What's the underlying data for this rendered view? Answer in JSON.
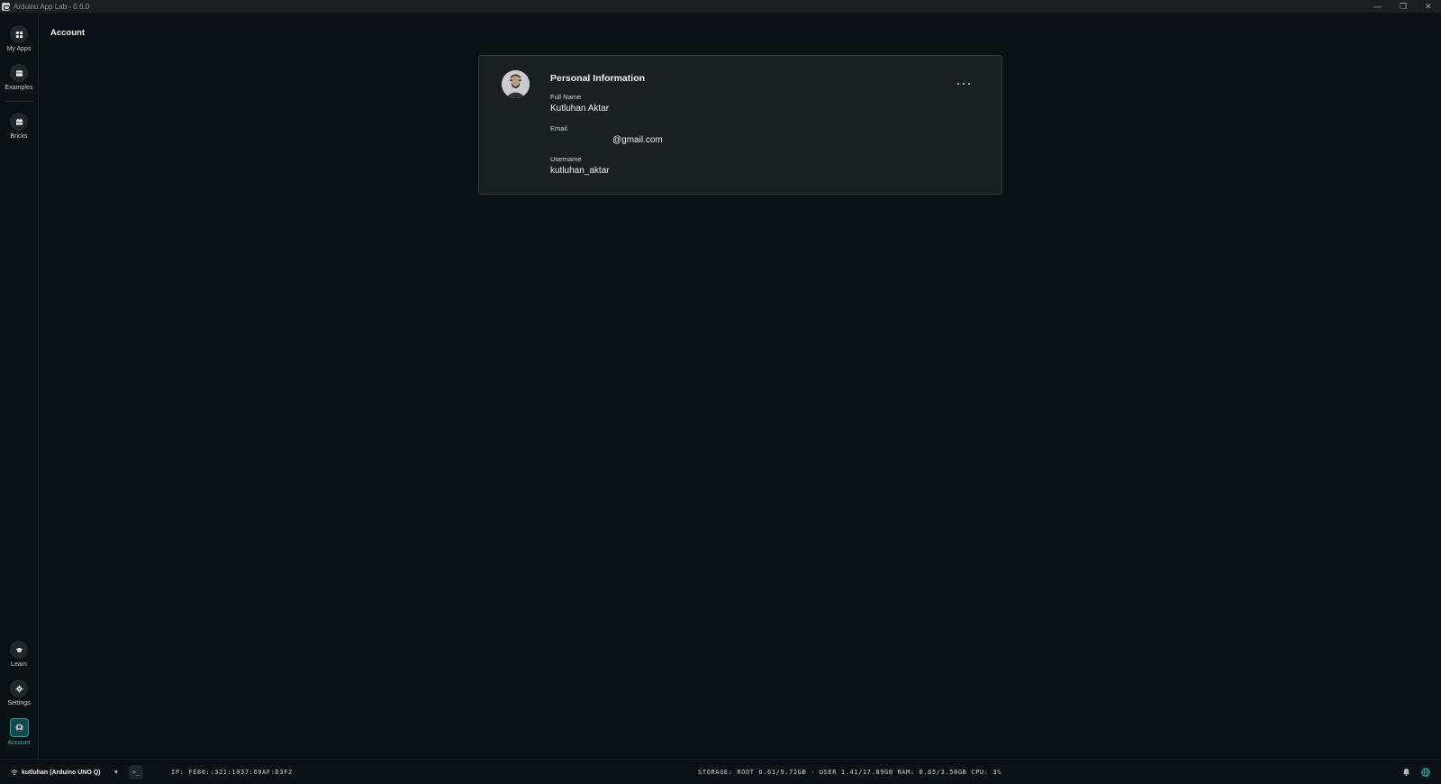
{
  "window": {
    "title": "Arduino App Lab - 0.6.0"
  },
  "sidebar": {
    "top_items": [
      {
        "label": "My Apps",
        "icon": "grid-icon"
      },
      {
        "label": "Examples",
        "icon": "examples-icon"
      },
      {
        "label": "Bricks",
        "icon": "bricks-icon"
      }
    ],
    "bottom_items": [
      {
        "label": "Learn",
        "icon": "graduation-cap-icon"
      },
      {
        "label": "Settings",
        "icon": "gear-icon"
      },
      {
        "label": "Account",
        "icon": "avatar-icon",
        "active": true
      }
    ]
  },
  "page": {
    "title": "Account"
  },
  "personal_info": {
    "heading": "Personal Information",
    "full_name_label": "Full Name",
    "full_name": "Kutluhan Aktar",
    "email_label": "Email",
    "email": "@gmail.com",
    "username_label": "Username",
    "username": "kutluhan_aktar",
    "more_menu": "more-horizontal-icon"
  },
  "statusbar": {
    "board": "kutluhan (Arduino UNO Q)",
    "terminal": ">_",
    "ip": "IP: FE80::321:1037:69AF:D3F2",
    "stats": "STORAGE: ROOT 6.61/9.72GB - USER 1.41/17.89GB   RAM: 0.65/3.58GB   CPU: 3%"
  },
  "colors": {
    "background": "#0a1114",
    "card": "#1a1f22",
    "accent": "#3ab0b3",
    "titlebar": "#1c1f21"
  }
}
